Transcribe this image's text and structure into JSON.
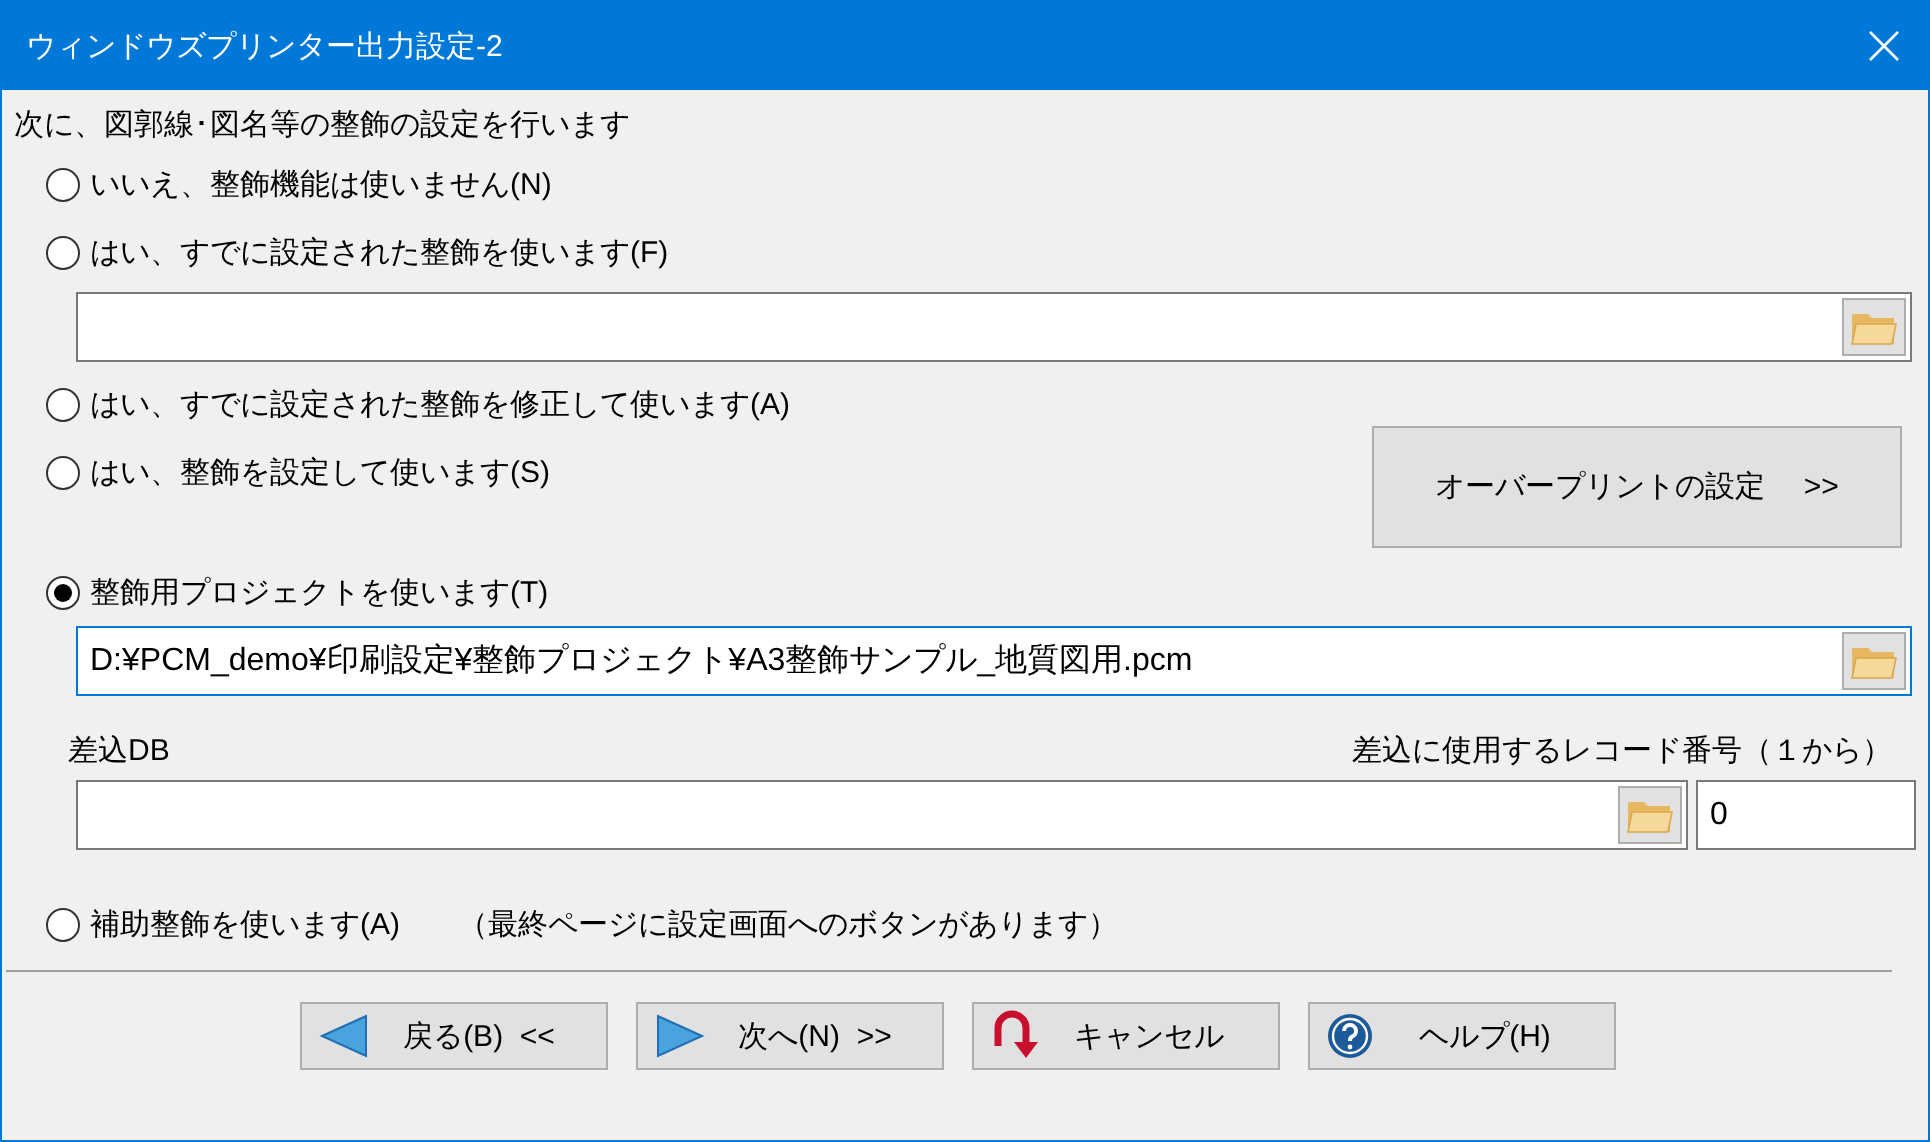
{
  "window": {
    "title": "ウィンドウズプリンター出力設定-2"
  },
  "intro": "次に、図郭線･図名等の整飾の設定を行います",
  "options": [
    {
      "label": "いいえ、整飾機能は使いません(N)",
      "selected": false
    },
    {
      "label": "はい、すでに設定された整飾を使います(F)",
      "selected": false
    },
    {
      "label": "はい、すでに設定された整飾を修正して使います(A)",
      "selected": false
    },
    {
      "label": "はい、整飾を設定して使います(S)",
      "selected": false
    },
    {
      "label": "整飾用プロジェクトを使います(T)",
      "selected": true
    },
    {
      "label": "補助整飾を使います(A)",
      "selected": false,
      "note": "（最終ページに設定画面へのボタンがあります）"
    }
  ],
  "overprint_button": "オーバープリントの設定　 >>",
  "project_path": {
    "value": "D:¥PCM_demo¥印刷設定¥整飾プロジェクト¥A3整飾サンプル_地質図用.pcm"
  },
  "merge_db": {
    "label": "差込DB"
  },
  "record_number": {
    "label": "差込に使用するレコード番号（１から）",
    "value": "0"
  },
  "buttons": [
    {
      "kind": "back",
      "label": "戻る(B)  <<"
    },
    {
      "kind": "next",
      "label": "次へ(N)  >>"
    },
    {
      "kind": "cancel",
      "label": "キャンセル"
    },
    {
      "kind": "help",
      "label": "ヘルプ(H)"
    }
  ]
}
